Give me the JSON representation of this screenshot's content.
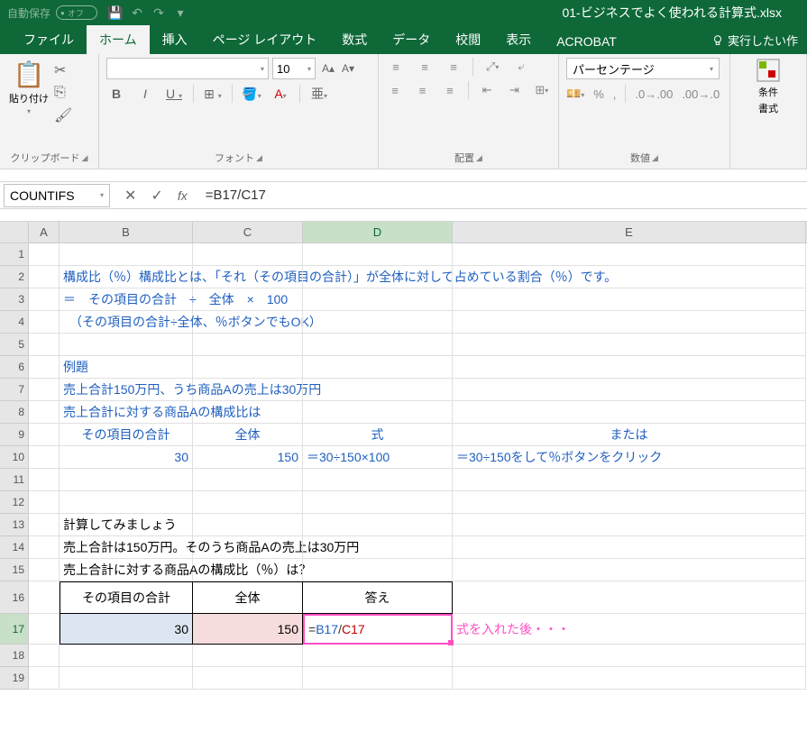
{
  "titlebar": {
    "autosave_label": "自動保存",
    "autosave_state": "オフ",
    "filename": "01-ビジネスでよく使われる計算式.xlsx"
  },
  "tabs": {
    "file": "ファイル",
    "home": "ホーム",
    "insert": "挿入",
    "page_layout": "ページ レイアウト",
    "formulas": "数式",
    "data": "データ",
    "review": "校閲",
    "view": "表示",
    "acrobat": "ACROBAT",
    "tell_me": "実行したい作"
  },
  "ribbon": {
    "clipboard": {
      "paste": "貼り付け",
      "label": "クリップボード"
    },
    "font": {
      "size": "10",
      "label": "フォント",
      "B": "B",
      "I": "I",
      "U": "U",
      "A": "A",
      "furigana": "亜"
    },
    "alignment": {
      "label": "配置"
    },
    "number": {
      "format": "パーセンテージ",
      "label": "数値"
    },
    "styles": {
      "cond": "条件",
      "fmt": "書式"
    }
  },
  "formula_bar": {
    "name_box": "COUNTIFS",
    "formula": "=B17/C17"
  },
  "columns": [
    "A",
    "B",
    "C",
    "D",
    "E"
  ],
  "rows_visible": [
    1,
    2,
    3,
    4,
    5,
    6,
    7,
    8,
    9,
    10,
    11,
    12,
    13,
    14,
    15,
    16,
    17,
    18,
    19
  ],
  "cells": {
    "B2": "構成比（％）構成比とは、「それ（その項目の合計）」が全体に対して占めている割合（％）です。",
    "B3": "＝　その項目の合計　÷　全体　×　100",
    "B4": "　（その項目の合計÷全体、％ボタンでもOK）",
    "B6": "例題",
    "B7": "売上合計150万円、うち商品Aの売上は30万円",
    "B8": "売上合計に対する商品Aの構成比は",
    "B9": "その項目の合計",
    "C9": "全体",
    "D9": "式",
    "E9": "または",
    "B10": "30",
    "C10": "150",
    "D10": "＝30÷150×100",
    "E10": "＝30÷150をして％ボタンをクリック",
    "B13": "計算してみましょう",
    "B14": "売上合計は150万円。そのうち商品Aの売上は30万円",
    "B15": "売上合計に対する商品Aの構成比（％）は？",
    "B16": "その項目の合計",
    "C16": "全体",
    "D16": "答え",
    "B17": "30",
    "C17": "150",
    "D17_eq": "=",
    "D17_ref1": "B17",
    "D17_op": "/",
    "D17_ref2": "C17",
    "E17": "式を入れた後・・・"
  }
}
